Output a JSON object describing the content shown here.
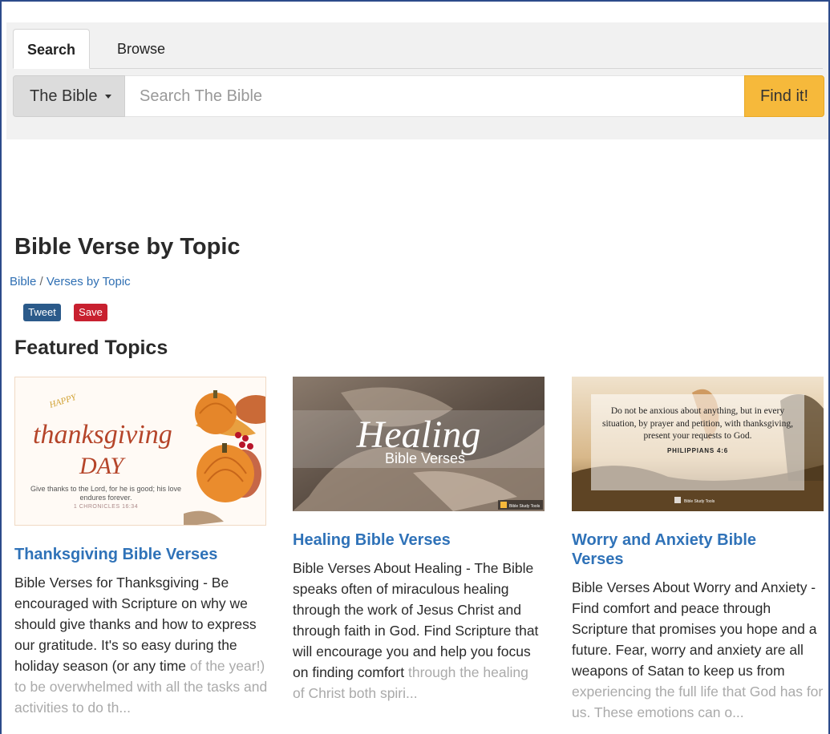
{
  "tabs": [
    {
      "label": "Search"
    },
    {
      "label": "Browse"
    }
  ],
  "search": {
    "scope_label": "The Bible",
    "placeholder": "Search The Bible",
    "button_label": "Find it!"
  },
  "page": {
    "title": "Bible Verse by Topic",
    "breadcrumb": {
      "root": "Bible",
      "separator": "/",
      "current": "Verses by Topic"
    },
    "tweet_label": "Tweet",
    "save_label": "Save",
    "section_title": "Featured Topics"
  },
  "cards": [
    {
      "title": "Thanksgiving Bible Verses",
      "desc": "Bible Verses for Thanksgiving - Be encouraged with Scripture on why we should give thanks and how to express our gratitude. It's so easy during the holiday season (or any time",
      "desc_fade": "of the year!) to be overwhelmed with all the tasks and activities to do th...",
      "image": {
        "line1": "HAPPY",
        "line2": "thanksgiving",
        "line3": "DAY",
        "verse": "Give thanks to the Lord, for he is good; his love endures forever.",
        "reference": "1 CHRONICLES 16:34"
      }
    },
    {
      "title": "Healing Bible Verses",
      "desc": "Bible Verses About Healing - The Bible speaks often of miraculous healing through the work of Jesus Christ and through faith in God. Find Scripture that will encourage you and help you focus on finding comfort",
      "desc_fade": "through the healing of Christ both spiri...",
      "image": {
        "script": "Healing",
        "sub": "Bible Verses",
        "brand": "Bible Study Tools"
      }
    },
    {
      "title": "Worry and Anxiety Bible Verses",
      "desc": "Bible Verses About Worry and Anxiety - Find comfort and peace through Scripture that promises you hope and a future. Fear, worry and anxiety are all weapons of Satan to keep us from",
      "desc_fade": "experiencing the full life that God has for us. These emotions can o...",
      "image": {
        "quote": "Do not be anxious about anything, but in every situation, by prayer and petition, with thanksgiving, present your requests to God.",
        "reference": "PHILIPPIANS 4:6",
        "brand": "Bible Study Tools"
      }
    }
  ],
  "colors": {
    "link": "#2f72b8",
    "find_button": "#f6b93b",
    "tweet": "#2b5a8a",
    "save": "#c8202f",
    "panel": "#f1f1f1"
  }
}
